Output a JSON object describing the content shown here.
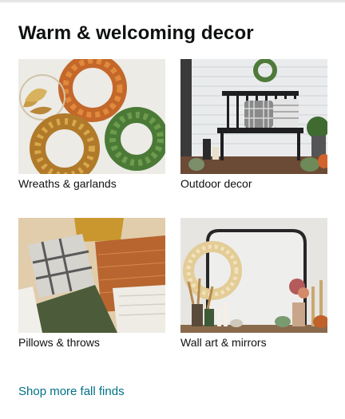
{
  "card": {
    "title": "Warm & welcoming decor",
    "tiles": [
      {
        "label": "Wreaths & garlands"
      },
      {
        "label": "Outdoor decor"
      },
      {
        "label": "Pillows & throws"
      },
      {
        "label": "Wall art & mirrors"
      }
    ],
    "footer_link": "Shop more fall finds"
  },
  "colors": {
    "link": "#007185",
    "text": "#0f1111"
  }
}
